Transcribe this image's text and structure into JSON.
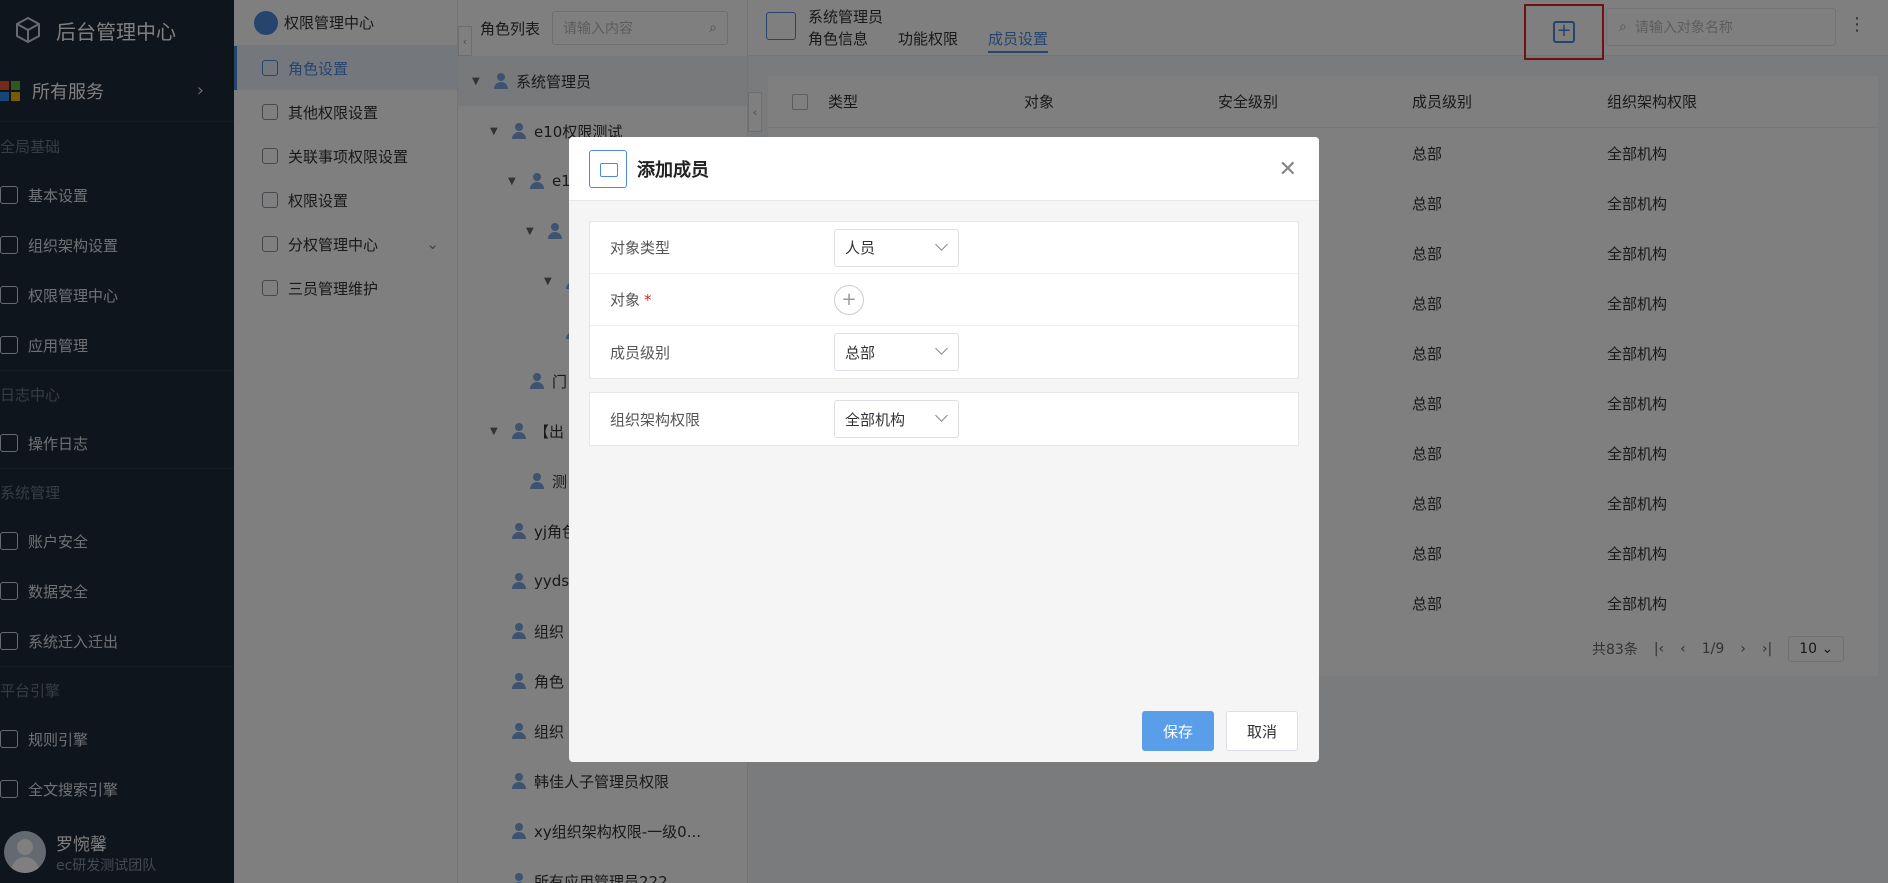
{
  "app": {
    "title": "后台管理中心",
    "all_services": "所有服务"
  },
  "sidebar": {
    "groups": [
      {
        "label": "全局基础",
        "items": [
          "基本设置",
          "组织架构设置",
          "权限管理中心",
          "应用管理"
        ]
      },
      {
        "label": "日志中心",
        "items": [
          "操作日志"
        ]
      },
      {
        "label": "系统管理",
        "items": [
          "账户安全",
          "数据安全",
          "系统迁入迁出"
        ]
      },
      {
        "label": "平台引擎",
        "items": [
          "规则引擎",
          "全文搜索引擎"
        ]
      }
    ],
    "user": {
      "name": "罗惋馨",
      "team": "ec研发测试团队"
    }
  },
  "submenu": {
    "title": "权限管理中心",
    "items": [
      "角色设置",
      "其他权限设置",
      "关联事项权限设置",
      "权限设置",
      "分权管理中心",
      "三员管理维护"
    ]
  },
  "tree": {
    "header": "角色列表",
    "search_placeholder": "请输入内容",
    "nodes": [
      {
        "label": "系统管理员",
        "depth": 0,
        "caret": "▼",
        "selected": true
      },
      {
        "label": "e10权限测试",
        "depth": 1,
        "caret": "▼"
      },
      {
        "label": "e1",
        "depth": 2,
        "caret": "▼"
      },
      {
        "label": "",
        "depth": 3,
        "caret": "▼"
      },
      {
        "label": "",
        "depth": 4,
        "caret": "▼"
      },
      {
        "label": "",
        "depth": 4,
        "caret": ""
      },
      {
        "label": "门",
        "depth": 2,
        "caret": ""
      },
      {
        "label": "【出",
        "depth": 1,
        "caret": "▼"
      },
      {
        "label": "测",
        "depth": 2,
        "caret": ""
      },
      {
        "label": "yj角色",
        "depth": 1,
        "caret": ""
      },
      {
        "label": "yyds",
        "depth": 1,
        "caret": ""
      },
      {
        "label": "组织",
        "depth": 1,
        "caret": ""
      },
      {
        "label": "角色",
        "depth": 1,
        "caret": ""
      },
      {
        "label": "组织",
        "depth": 1,
        "caret": ""
      },
      {
        "label": "韩佳人子管理员权限",
        "depth": 1,
        "caret": ""
      },
      {
        "label": "xy组织架构权限-一级0...",
        "depth": 1,
        "caret": ""
      },
      {
        "label": "所有应用管理员222",
        "depth": 1,
        "caret": ""
      }
    ]
  },
  "main": {
    "role_title": "系统管理员",
    "tabs": [
      "角色信息",
      "功能权限",
      "成员设置"
    ],
    "active_tab": 2,
    "search_placeholder": "请输入对象名称",
    "columns": [
      "类型",
      "对象",
      "安全级别",
      "成员级别",
      "组织架构权限"
    ],
    "rows": [
      [
        "",
        "",
        "",
        "总部",
        "全部机构"
      ],
      [
        "",
        "",
        "",
        "总部",
        "全部机构"
      ],
      [
        "",
        "",
        "",
        "总部",
        "全部机构"
      ],
      [
        "",
        "",
        "",
        "总部",
        "全部机构"
      ],
      [
        "",
        "",
        "",
        "总部",
        "全部机构"
      ],
      [
        "",
        "",
        "",
        "总部",
        "全部机构"
      ],
      [
        "",
        "",
        "",
        "总部",
        "全部机构"
      ],
      [
        "",
        "",
        "",
        "总部",
        "全部机构"
      ],
      [
        "",
        "",
        "",
        "总部",
        "全部机构"
      ],
      [
        "",
        "",
        "",
        "总部",
        "全部机构"
      ]
    ],
    "pager": {
      "total": "共83条",
      "page": "1/9",
      "page_size": "10"
    }
  },
  "modal": {
    "title": "添加成员",
    "fields": {
      "object_type_label": "对象类型",
      "object_type_value": "人员",
      "object_label": "对象",
      "object_required": "*",
      "member_level_label": "成员级别",
      "member_level_value": "总部",
      "org_perm_label": "组织架构权限",
      "org_perm_value": "全部机构"
    },
    "save": "保存",
    "cancel": "取消"
  },
  "colors": {
    "accent": "#4a89dc",
    "sidebar_bg": "#1f2a38",
    "highlight_border": "#e02020",
    "save_button": "#5a9de8"
  }
}
